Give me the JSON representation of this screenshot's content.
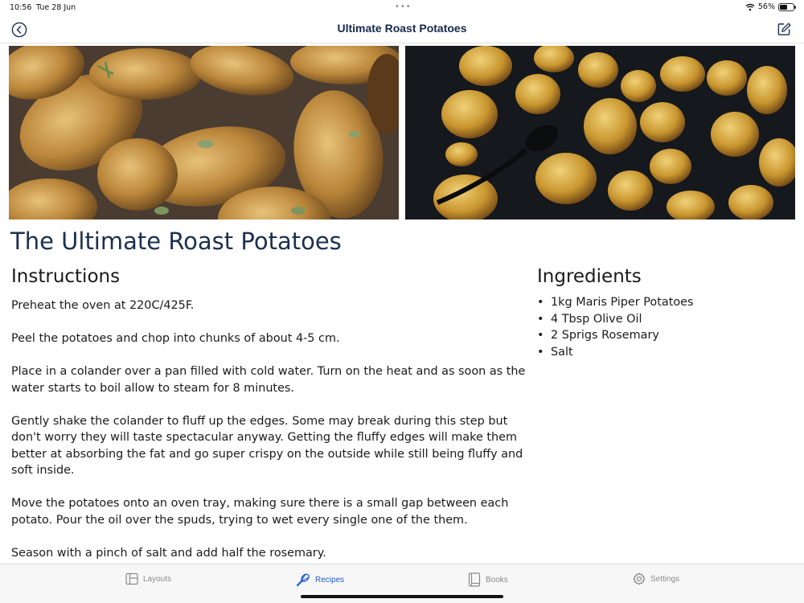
{
  "status": {
    "time": "10:56",
    "date": "Tue 28 Jun",
    "dots": "•••",
    "battery": "56%",
    "battery_level": 0.56
  },
  "nav": {
    "title": "Ultimate Roast Potatoes",
    "back_icon": "chevron-left-circle-icon",
    "edit_icon": "square-pencil-icon"
  },
  "recipe": {
    "title": "The Ultimate Roast Potatoes",
    "instructions_heading": "Instructions",
    "ingredients_heading": "Ingredients",
    "instructions": [
      "Preheat the oven at 220C/425F.",
      "Peel the potatoes and chop into chunks of about 4-5 cm.",
      "Place in a colander over a pan filled with cold water. Turn on the heat and as soon as the water starts to boil allow to steam for 8 minutes.",
      "Gently shake the colander to fluff up the edges. Some may break during this step but don't worry they will taste spectacular anyway. Getting the fluffy edges will make them better at absorbing the fat and go super crispy on the outside while still being fluffy and soft inside.",
      "Move the potatoes onto an oven tray, making sure there is a small gap between each potato. Pour the oil over the spuds, trying to wet every single one of the them.",
      "Season with a pinch of salt and add half the rosemary."
    ],
    "ingredients": [
      "1kg Maris Piper Potatoes",
      "4 Tbsp Olive Oil",
      "2 Sprigs Rosemary",
      "Salt"
    ]
  },
  "tabs": [
    {
      "label": "Layouts",
      "icon": "layout-icon",
      "active": false
    },
    {
      "label": "Recipes",
      "icon": "whisk-icon",
      "active": true
    },
    {
      "label": "Books",
      "icon": "book-icon",
      "active": false
    },
    {
      "label": "Settings",
      "icon": "gear-icon",
      "active": false
    }
  ],
  "colors": {
    "accent": "#1f5bd6",
    "title": "#1b2f4f",
    "nav_title": "#15294d"
  }
}
